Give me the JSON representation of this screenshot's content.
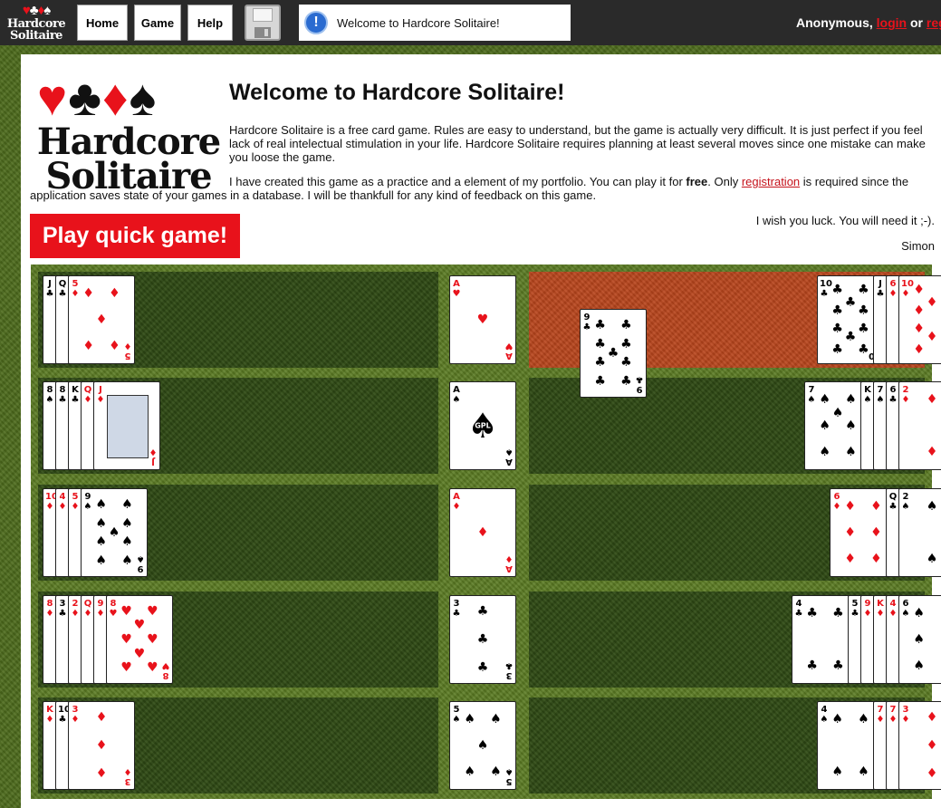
{
  "topbar": {
    "logo_suits": [
      "♥",
      "♣",
      "♦",
      "♠"
    ],
    "logo_words": [
      "Hardcore",
      "Solitaire"
    ],
    "nav": [
      {
        "label": "Home"
      },
      {
        "label": "Game"
      },
      {
        "label": "Help"
      }
    ],
    "save_icon": "floppy-disk-icon",
    "message": {
      "icon": "!",
      "text": "Welcome to Hardcore Solitaire!"
    },
    "user": {
      "name": "Anonymous,",
      "login": "login",
      "or": "or",
      "register": "regi"
    }
  },
  "intro": {
    "title": "Welcome to Hardcore Solitaire!",
    "p1": "Hardcore Solitaire is a free card game. Rules are easy to understand, but the game is actually very difficult. It is just perfect if you feel lack of real intelectual stimulation in your life. Hardcore Solitaire requires planning at least several moves since one mistake can make you loose the game.",
    "p2_before": "I have created this game as a practice and a element of my portfolio. You can play it for ",
    "p2_bold": "free",
    "p2_mid": ". Only ",
    "p2_link": "registration",
    "p2_after": " is required since the",
    "p2_line2": "application saves state of your games in a database. I will be thankfull for any kind of feedback on this game.",
    "luck": "I wish you luck. You will need it ;-).",
    "signature": "Simon",
    "play_button": "Play quick game!"
  },
  "colors": {
    "accent_red": "#e8121b",
    "board_green": "#5a7a22",
    "zone_green": "#2f4a14",
    "highlight_orange": "#b8451c",
    "topbar": "#2a2a2a"
  },
  "board": {
    "rows": [
      {
        "left": [
          {
            "r": "J",
            "s": "♣"
          },
          {
            "r": "Q",
            "s": "♣"
          },
          {
            "r": "5",
            "s": "♦"
          }
        ],
        "foundation": {
          "r": "A",
          "s": "♥"
        },
        "right": [
          {
            "r": "10",
            "s": "♣"
          },
          {
            "r": "J",
            "s": "♣"
          },
          {
            "r": "6",
            "s": "♦"
          },
          {
            "r": "10",
            "s": "♦"
          }
        ],
        "highlighted": true
      },
      {
        "left": [
          {
            "r": "8",
            "s": "♠"
          },
          {
            "r": "8",
            "s": "♣"
          },
          {
            "r": "K",
            "s": "♣"
          },
          {
            "r": "Q",
            "s": "♦"
          },
          {
            "r": "J",
            "s": "♦"
          }
        ],
        "foundation": {
          "r": "A",
          "s": "♠",
          "gpl": "GPL"
        },
        "right": [
          {
            "r": "7",
            "s": "♠"
          },
          {
            "r": "K",
            "s": "♠"
          },
          {
            "r": "7",
            "s": "♠"
          },
          {
            "r": "6",
            "s": "♣"
          },
          {
            "r": "2",
            "s": "♦"
          }
        ],
        "highlighted": false
      },
      {
        "left": [
          {
            "r": "10",
            "s": "♦"
          },
          {
            "r": "4",
            "s": "♦"
          },
          {
            "r": "5",
            "s": "♦"
          },
          {
            "r": "9",
            "s": "♠"
          }
        ],
        "foundation": {
          "r": "A",
          "s": "♦"
        },
        "right": [
          {
            "r": "6",
            "s": "♦"
          },
          {
            "r": "Q",
            "s": "♣"
          },
          {
            "r": "2",
            "s": "♠"
          }
        ],
        "highlighted": false
      },
      {
        "left": [
          {
            "r": "8",
            "s": "♦"
          },
          {
            "r": "3",
            "s": "♣"
          },
          {
            "r": "2",
            "s": "♦"
          },
          {
            "r": "Q",
            "s": "♦"
          },
          {
            "r": "9",
            "s": "♦"
          },
          {
            "r": "8",
            "s": "♥"
          }
        ],
        "foundation": {
          "r": "3",
          "s": "♣"
        },
        "right": [
          {
            "r": "4",
            "s": "♣"
          },
          {
            "r": "5",
            "s": "♣"
          },
          {
            "r": "9",
            "s": "♦"
          },
          {
            "r": "K",
            "s": "♦"
          },
          {
            "r": "4",
            "s": "♦"
          },
          {
            "r": "6",
            "s": "♠"
          }
        ],
        "highlighted": false
      },
      {
        "left": [
          {
            "r": "K",
            "s": "♦"
          },
          {
            "r": "10",
            "s": "♣"
          },
          {
            "r": "3",
            "s": "♦"
          }
        ],
        "foundation": {
          "r": "5",
          "s": "♠"
        },
        "right": [
          {
            "r": "4",
            "s": "♠"
          },
          {
            "r": "7",
            "s": "♦"
          },
          {
            "r": "7",
            "s": "♦"
          },
          {
            "r": "3",
            "s": "♦"
          }
        ],
        "highlighted": false
      }
    ],
    "dragging": {
      "r": "9",
      "s": "♣"
    }
  }
}
